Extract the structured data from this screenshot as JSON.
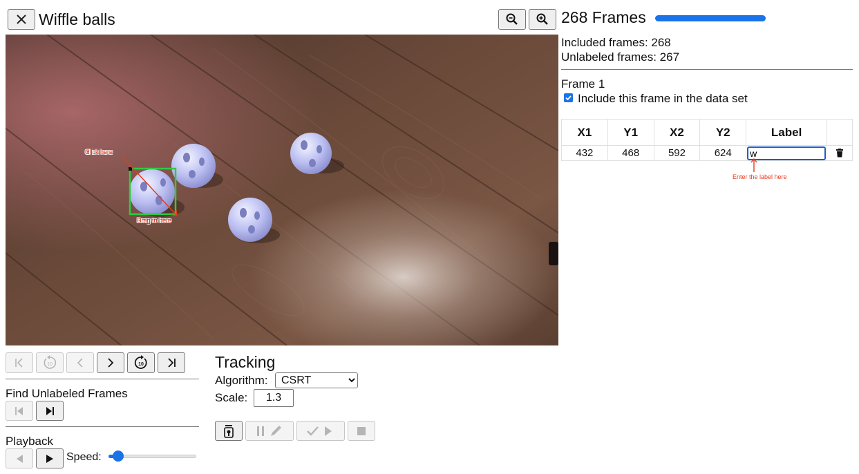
{
  "header": {
    "title": "Wiffle balls",
    "close_icon": "close-icon",
    "zoom_out_icon": "zoom-out-icon",
    "zoom_in_icon": "zoom-in-icon"
  },
  "video": {
    "annotation_click": "Click here",
    "annotation_drag": "Drag to here",
    "bounding_box_color": "#2ecc40",
    "annotation_color": "#e53b1f"
  },
  "navigation": {
    "buttons": [
      {
        "icon": "first-frame-icon",
        "enabled": false
      },
      {
        "icon": "back-10-icon",
        "enabled": false
      },
      {
        "icon": "previous-frame-icon",
        "enabled": false
      },
      {
        "icon": "next-frame-icon",
        "enabled": true
      },
      {
        "icon": "forward-10-icon",
        "enabled": true
      },
      {
        "icon": "last-frame-icon",
        "enabled": true
      }
    ]
  },
  "find_unlabeled": {
    "heading": "Find Unlabeled Frames",
    "buttons": [
      {
        "icon": "previous-unlabeled-icon",
        "enabled": false
      },
      {
        "icon": "next-unlabeled-icon",
        "enabled": true
      }
    ]
  },
  "playback": {
    "heading": "Playback",
    "speed_label": "Speed:",
    "speed_value": 0.05,
    "buttons": [
      {
        "icon": "play-reverse-icon",
        "enabled": false
      },
      {
        "icon": "play-icon",
        "enabled": true
      }
    ]
  },
  "tracking": {
    "heading": "Tracking",
    "algorithm_label": "Algorithm:",
    "algorithm_value": "CSRT",
    "scale_label": "Scale:",
    "scale_value": "1.3",
    "buttons": [
      {
        "icon": "start-tracking-icon",
        "enabled": true
      },
      {
        "icon": "pause-edit-icon",
        "enabled": false
      },
      {
        "icon": "accept-continue-icon",
        "enabled": false
      },
      {
        "icon": "stop-icon",
        "enabled": false
      }
    ]
  },
  "summary": {
    "frames_title": "268 Frames",
    "progress_fraction": 1.0,
    "accent_color": "#1a73e8",
    "included": "Included frames: 268",
    "unlabeled": "Unlabeled frames: 267"
  },
  "frame": {
    "heading": "Frame 1",
    "include_checkbox_label": "Include this frame in the data set",
    "include_checked": true
  },
  "boxes_table": {
    "headers": [
      "X1",
      "Y1",
      "X2",
      "Y2",
      "Label"
    ],
    "rows": [
      {
        "x1": "432",
        "y1": "468",
        "x2": "592",
        "y2": "624",
        "label": "w"
      }
    ],
    "delete_icon": "trash-icon",
    "label_annotation": "Enter the label here"
  }
}
